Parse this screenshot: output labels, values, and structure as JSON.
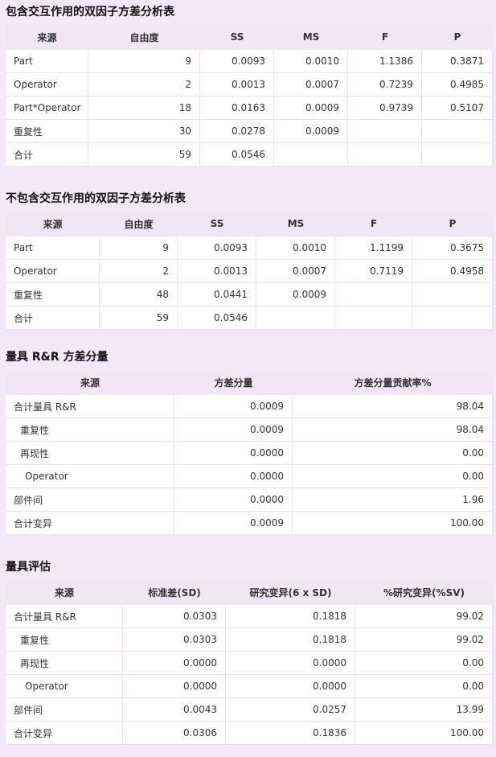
{
  "s1": {
    "title": "包含交互作用的双因子方差分析表",
    "headers": [
      "来源",
      "自由度",
      "SS",
      "MS",
      "F",
      "P"
    ],
    "rows": [
      [
        "Part",
        "9",
        "0.0093",
        "0.0010",
        "1.1386",
        "0.3871"
      ],
      [
        "Operator",
        "2",
        "0.0013",
        "0.0007",
        "0.7239",
        "0.4985"
      ],
      [
        "Part*Operator",
        "18",
        "0.0163",
        "0.0009",
        "0.9739",
        "0.5107"
      ],
      [
        "重复性",
        "30",
        "0.0278",
        "0.0009",
        "",
        ""
      ],
      [
        "合计",
        "59",
        "0.0546",
        "",
        "",
        ""
      ]
    ]
  },
  "s2": {
    "title": "不包含交互作用的双因子方差分析表",
    "headers": [
      "来源",
      "自由度",
      "SS",
      "MS",
      "F",
      "P"
    ],
    "rows": [
      [
        "Part",
        "9",
        "0.0093",
        "0.0010",
        "1.1199",
        "0.3675"
      ],
      [
        "Operator",
        "2",
        "0.0013",
        "0.0007",
        "0.7119",
        "0.4958"
      ],
      [
        "重复性",
        "48",
        "0.0441",
        "0.0009",
        "",
        ""
      ],
      [
        "合计",
        "59",
        "0.0546",
        "",
        "",
        ""
      ]
    ]
  },
  "s3": {
    "title": "量具 R&R 方差分量",
    "headers": [
      "来源",
      "方差分量",
      "方差分量贡献率%"
    ],
    "rows": [
      [
        "合计量具 R&R",
        "0.0009",
        "98.04"
      ],
      [
        "重复性",
        "0.0009",
        "98.04"
      ],
      [
        "再现性",
        "0.0000",
        "0.00"
      ],
      [
        "Operator",
        "0.0000",
        "0.00"
      ],
      [
        "部件间",
        "0.0000",
        "1.96"
      ],
      [
        "合计变异",
        "0.0009",
        "100.00"
      ]
    ]
  },
  "s4": {
    "title": "量具评估",
    "headers": [
      "来源",
      "标准差(SD)",
      "研究变异(6 x SD)",
      "%研究变异(%SV)"
    ],
    "rows": [
      [
        "合计量具 R&R",
        "0.0303",
        "0.1818",
        "99.02"
      ],
      [
        "重复性",
        "0.0303",
        "0.1818",
        "99.02"
      ],
      [
        "再现性",
        "0.0000",
        "0.0000",
        "0.00"
      ],
      [
        "Operator",
        "0.0000",
        "0.0000",
        "0.00"
      ],
      [
        "部件间",
        "0.0043",
        "0.0257",
        "13.99"
      ],
      [
        "合计变异",
        "0.0306",
        "0.1836",
        "100.00"
      ]
    ]
  }
}
